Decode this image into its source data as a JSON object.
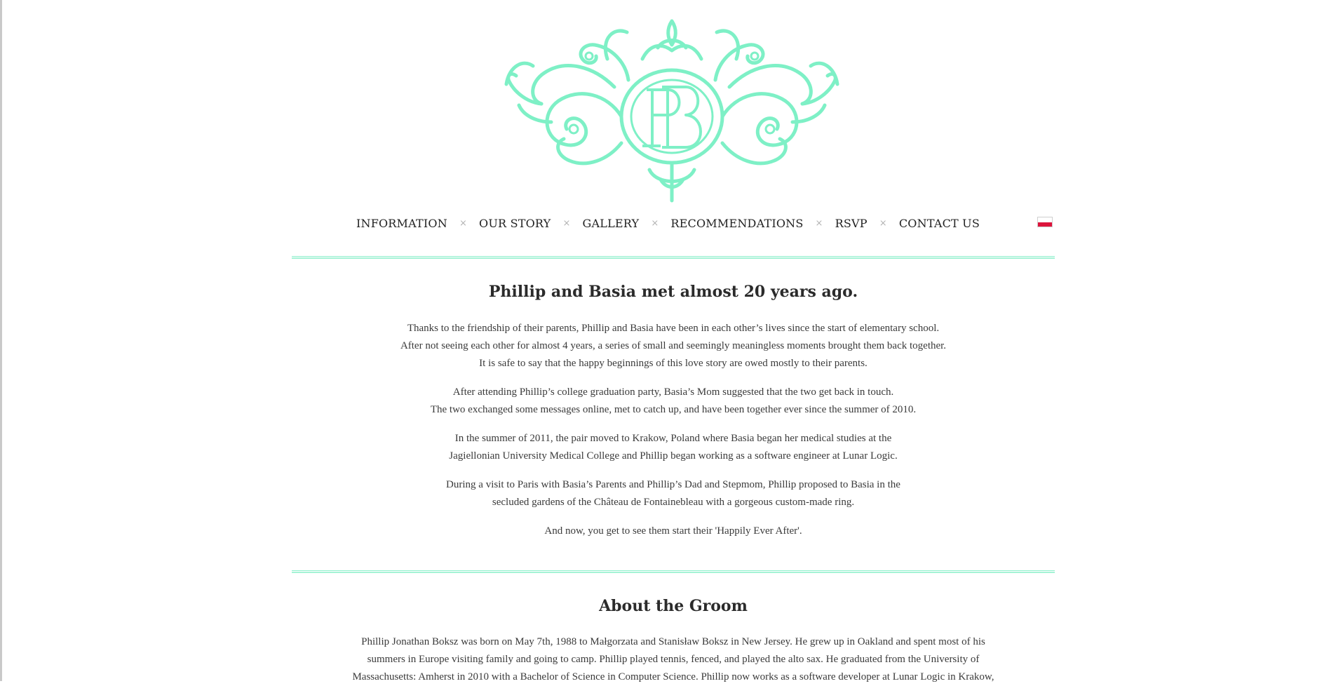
{
  "brand": {
    "monogram": "PB",
    "accent_color": "#8ff0cc",
    "crest_color": "#7ef0c6"
  },
  "nav": {
    "items": [
      "INFORMATION",
      "OUR STORY",
      "GALLERY",
      "RECOMMENDATIONS",
      "RSVP",
      "CONTACT US"
    ],
    "separator": "×",
    "language_flag": "poland-flag-icon"
  },
  "story": {
    "heading": "Phillip and Basia met almost 20 years ago.",
    "paragraphs": [
      [
        "Thanks to the friendship of their parents, Phillip and Basia have been in each other’s lives since the start of elementary school.",
        "After not seeing each other for almost 4 years, a series of small and seemingly meaningless moments brought them back together.",
        "It is safe to say that the happy beginnings of this love story are owed mostly to their parents."
      ],
      [
        "After attending Phillip’s college graduation party, Basia’s Mom suggested that the two get back in touch.",
        "The two exchanged some messages online, met to catch up, and have been together ever since the summer of 2010."
      ],
      [
        "In the summer of 2011, the pair moved to Krakow, Poland where Basia began her medical studies at the",
        "Jagiellonian University Medical College and Phillip began working as a software engineer at Lunar Logic."
      ],
      [
        "During a visit to Paris with Basia’s Parents and Phillip’s Dad and Stepmom, Phillip proposed to Basia in the",
        "secluded gardens of the Château de Fontainebleau with a gorgeous custom-made ring."
      ],
      [
        "And now, you get to see them start their 'Happily Ever After'."
      ]
    ]
  },
  "groom": {
    "heading": "About the Groom",
    "lines": [
      "Phillip Jonathan Boksz was born on May 7th, 1988 to Małgorzata and Stanisław Boksz in New Jersey. He grew up in Oakland and spent most of his",
      "summers in Europe visiting family and going to camp. Phillip played tennis, fenced, and played the alto sax. He graduated from the University of",
      "Massachusetts: Amherst in 2010 with a Bachelor of Science in Computer Science. Phillip now works as a software developer at Lunar Logic in Krakow,"
    ]
  }
}
